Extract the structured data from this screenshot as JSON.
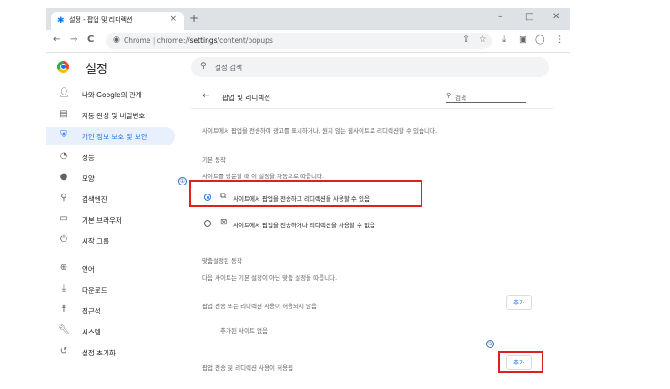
{
  "browser": {
    "tab_title": "설정 - 팝업 및 리디렉션",
    "tab_close": "×",
    "new_tab": "+",
    "window_controls": {
      "minimize": "–",
      "maximize": "□",
      "close": "✕"
    },
    "back_icon": "←",
    "forward_icon": "→",
    "reload_icon": "C",
    "url_prefix": "Chrome",
    "url_separator": "|",
    "url_scheme": "chrome://",
    "url_path": "settings",
    "url_rest": "/content/popups",
    "toolbar_icons": [
      "share-icon",
      "bookmark-star-icon",
      "download-icon",
      "sidepanel-icon",
      "profile-icon",
      "menu-icon"
    ]
  },
  "header": {
    "title": "설정",
    "search_placeholder": "설정 검색"
  },
  "sidebar": {
    "items": [
      {
        "label": "나와 Google의 관계",
        "icon": "person-icon"
      },
      {
        "label": "자동 완성 및 비밀번호",
        "icon": "clipboard-icon"
      },
      {
        "label": "개인 정보 보호 및 보안",
        "icon": "shield-icon",
        "active": true
      },
      {
        "label": "성능",
        "icon": "speedometer-icon"
      },
      {
        "label": "모양",
        "icon": "palette-icon"
      },
      {
        "label": "검색엔진",
        "icon": "search-icon"
      },
      {
        "label": "기본 브라우저",
        "icon": "browser-icon"
      },
      {
        "label": "시작 그룹",
        "icon": "power-icon"
      },
      {
        "label": "언어",
        "icon": "globe-icon"
      },
      {
        "label": "다운로드",
        "icon": "download-icon"
      },
      {
        "label": "접근성",
        "icon": "accessibility-icon"
      },
      {
        "label": "시스템",
        "icon": "wrench-icon"
      },
      {
        "label": "설정 초기화",
        "icon": "restore-icon"
      }
    ]
  },
  "content": {
    "title": "팝업 및 리디렉션",
    "search_placeholder": "검색",
    "description": "사이트에서 팝업을 전송하여 광고를 표시하거나, 원치 않는 웹사이트로 리디렉션할 수 있습니다.",
    "default_behavior_heading": "기본 동작",
    "default_behavior_desc": "사이트를 방문할 때 이 설정을 자동으로 따릅니다.",
    "options": [
      {
        "label": "사이트에서 팝업을 전송하고 리디렉션을 사용할 수 있음",
        "selected": true,
        "icon": "open-in-new-icon"
      },
      {
        "label": "사이트에서 팝업을 전송하거나 리디렉션을 사용할 수 없음",
        "selected": false,
        "icon": "popup-blocked-icon"
      }
    ],
    "custom_heading": "맞춤설정된 동작",
    "custom_desc": "다음 사이트는 기본 설정이 아닌 맞춤 설정을 따릅니다.",
    "not_allowed_label": "팝업 전송 또는 리디렉션 사용이 허용되지 않음",
    "add_button_1": "추가",
    "no_sites": "추가된 사이트 없음",
    "allowed_label": "팝업 전송 및 리디렉션 사용이 허용됨",
    "add_button_2": "추가"
  },
  "annotations": {
    "marker_1": "①",
    "marker_2": "②",
    "highlight_color": "#e02020"
  },
  "colors": {
    "accent": "#1a73e8",
    "active_bg": "#e8f0fe"
  }
}
